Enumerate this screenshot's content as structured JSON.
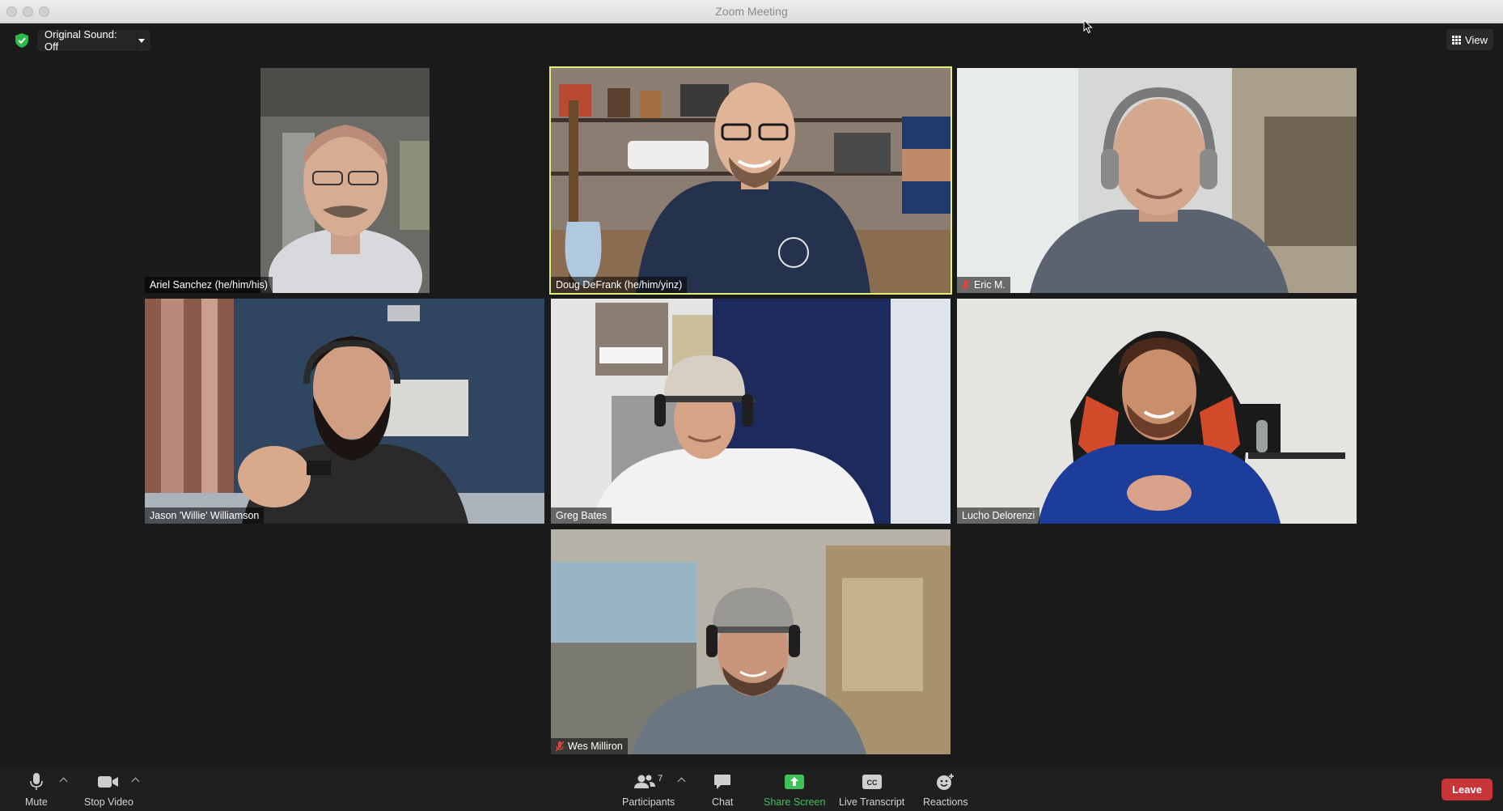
{
  "window": {
    "title": "Zoom Meeting"
  },
  "top_controls": {
    "original_sound_label": "Original Sound: Off",
    "view_label": "View"
  },
  "tiles": [
    {
      "name": "Ariel Sanchez (he/him/his)",
      "muted": false,
      "active_speaker": false
    },
    {
      "name": "Doug DeFrank (he/him/yinz)",
      "muted": false,
      "active_speaker": true
    },
    {
      "name": "Eric M.",
      "muted": true,
      "active_speaker": false
    },
    {
      "name": "Jason 'Willie' Williamson",
      "muted": false,
      "active_speaker": false
    },
    {
      "name": "Greg Bates",
      "muted": false,
      "active_speaker": false
    },
    {
      "name": "Lucho Delorenzi",
      "muted": false,
      "active_speaker": false
    },
    {
      "name": "Wes Milliron",
      "muted": true,
      "active_speaker": false
    }
  ],
  "toolbar": {
    "mute_label": "Mute",
    "stop_video_label": "Stop Video",
    "participants_label": "Participants",
    "participants_count": "7",
    "chat_label": "Chat",
    "share_screen_label": "Share Screen",
    "live_transcript_label": "Live Transcript",
    "reactions_label": "Reactions",
    "leave_label": "Leave"
  },
  "colors": {
    "background": "#1a1a1a",
    "active_speaker_border": "#dff07a",
    "share_green": "#3fc15a",
    "leave_red": "#c8353a",
    "muted_red": "#e0453b"
  }
}
